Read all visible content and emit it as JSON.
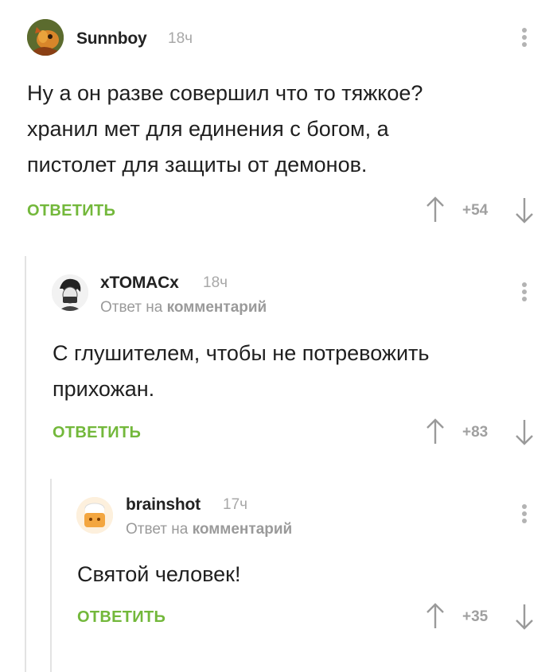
{
  "comments": [
    {
      "username": "Sunnboy",
      "time": "18ч",
      "reply_to": null,
      "text_lines": [
        "Ну а он разве совершил что то тяжкое?",
        "хранил мет для единения с богом, а",
        "пистолет для защиты от демонов."
      ],
      "reply_label": "ОТВЕТИТЬ",
      "rating": "+54"
    },
    {
      "username": "xTOMACx",
      "time": "18ч",
      "reply_to": {
        "prefix": "Ответ на",
        "target": "комментарий"
      },
      "text_lines": [
        "С глушителем, чтобы не потревожить",
        "прихожан."
      ],
      "reply_label": "ОТВЕТИТЬ",
      "rating": "+83"
    },
    {
      "username": "brainshot",
      "time": "17ч",
      "reply_to": {
        "prefix": "Ответ на",
        "target": "комментарий"
      },
      "text_lines": [
        "Святой человек!"
      ],
      "reply_label": "ОТВЕТИТЬ",
      "rating": "+35"
    }
  ],
  "icons": {
    "menu": "more-vertical-icon",
    "upvote": "arrow-up-icon",
    "downvote": "arrow-down-icon"
  },
  "colors": {
    "accent": "#73b83b",
    "muted": "#a8a8a8",
    "thread_line": "#e3e3e3"
  }
}
